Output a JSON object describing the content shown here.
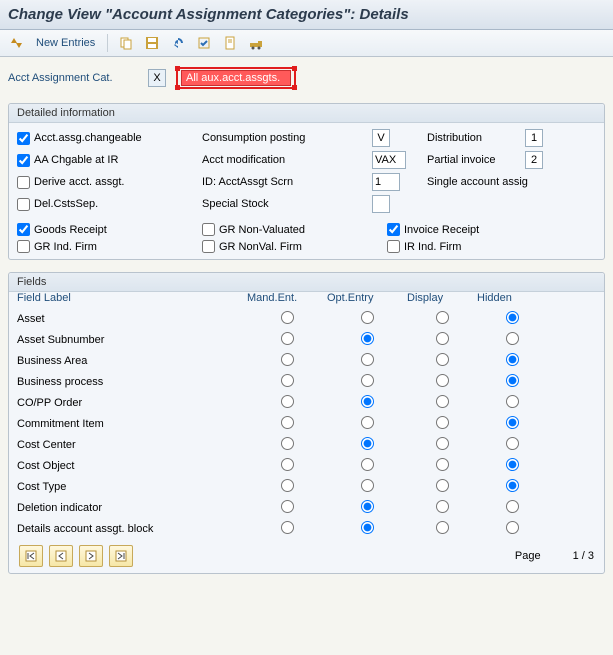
{
  "title": "Change View \"Account Assignment Categories\": Details",
  "toolbar": {
    "new_entries": "New Entries"
  },
  "header": {
    "label": "Acct Assignment Cat.",
    "code": "X",
    "desc": "All aux.acct.assgts."
  },
  "detail": {
    "title": "Detailed information",
    "cb_changeable": "Acct.assg.changeable",
    "cb_chg_ir": "AA Chgable at IR",
    "cb_derive": "Derive acct. assgt.",
    "cb_del": "Del.CstsSep.",
    "lbl_consumption": "Consumption posting",
    "val_consumption": "V",
    "lbl_acctmod": "Acct modification",
    "val_acctmod": "VAX",
    "lbl_idscrn": "ID: AcctAssgt Scrn",
    "val_idscrn": "1",
    "txt_single": "Single account assig",
    "lbl_special": "Special Stock",
    "val_special": "",
    "lbl_dist": "Distribution",
    "val_dist": "1",
    "lbl_partial": "Partial invoice",
    "val_partial": "2",
    "cb_gr": "Goods Receipt",
    "cb_gr_nonval": "GR Non-Valuated",
    "cb_inv": "Invoice Receipt",
    "cb_gr_firm": "GR Ind. Firm",
    "cb_gr_nvfirm": "GR NonVal. Firm",
    "cb_ir_firm": "IR Ind. Firm"
  },
  "fields": {
    "title": "Fields",
    "col_label": "Field Label",
    "col_mand": "Mand.Ent.",
    "col_opt": "Opt.Entry",
    "col_disp": "Display",
    "col_hidden": "Hidden",
    "rows": [
      {
        "label": "Asset",
        "sel": 3
      },
      {
        "label": "Asset Subnumber",
        "sel": 1
      },
      {
        "label": "Business Area",
        "sel": 3
      },
      {
        "label": "Business process",
        "sel": 3
      },
      {
        "label": "CO/PP Order",
        "sel": 1
      },
      {
        "label": "Commitment Item",
        "sel": 3
      },
      {
        "label": "Cost Center",
        "sel": 1
      },
      {
        "label": "Cost Object",
        "sel": 3
      },
      {
        "label": "Cost Type",
        "sel": 3
      },
      {
        "label": "Deletion indicator",
        "sel": 1
      },
      {
        "label": "Details account assgt. block",
        "sel": 1
      }
    ],
    "page_label": "Page",
    "page_value": "1 / 3"
  }
}
